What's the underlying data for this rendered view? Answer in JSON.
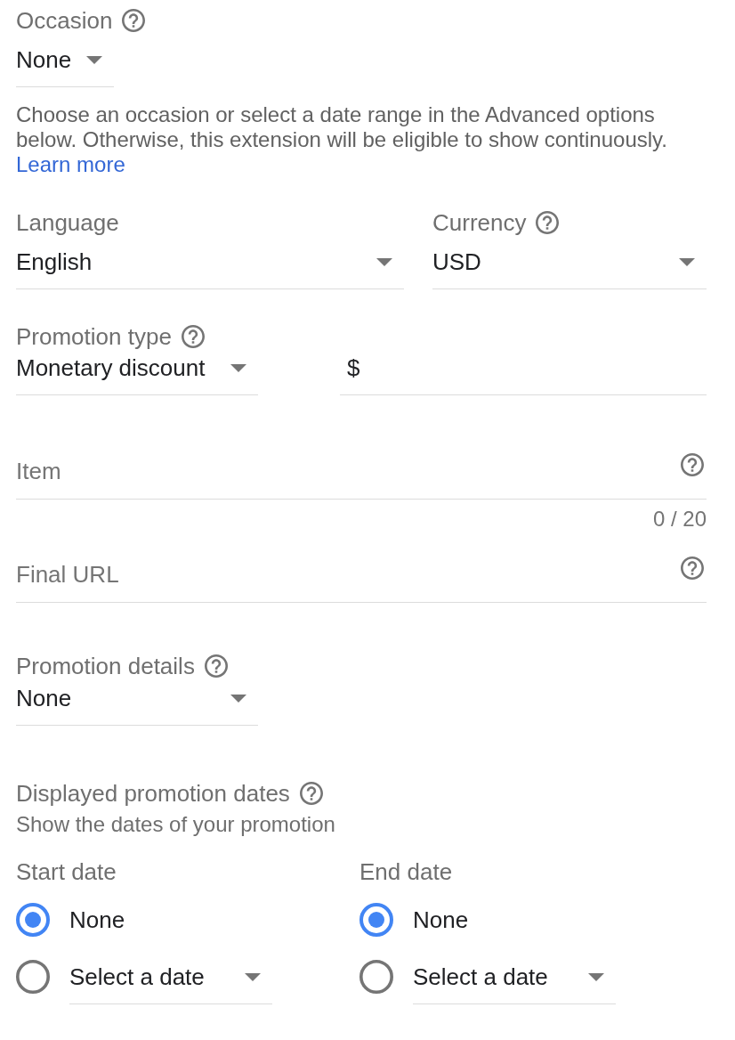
{
  "occasion": {
    "label": "Occasion",
    "help": true,
    "value": "None",
    "note": "Choose an occasion or select a date range in the Advanced options below. Otherwise, this extension will be eligible to show continuously.",
    "link": "Learn more"
  },
  "language": {
    "label": "Language",
    "help": false,
    "value": "English"
  },
  "currency": {
    "label": "Currency",
    "help": true,
    "value": "USD"
  },
  "promotion_type": {
    "label": "Promotion type",
    "help": true,
    "value": "Monetary discount"
  },
  "amount": {
    "prefix": "$"
  },
  "item": {
    "placeholder": "Item",
    "help": true,
    "counter": "0 / 20"
  },
  "final_url": {
    "placeholder": "Final URL",
    "help": true
  },
  "promotion_details": {
    "label": "Promotion details",
    "help": true,
    "value": "None"
  },
  "displayed_dates": {
    "title": "Displayed promotion dates",
    "help": true,
    "subtitle": "Show the dates of your promotion",
    "columns": [
      {
        "label": "Start date",
        "options": [
          {
            "kind": "plain",
            "label": "None",
            "selected": true
          },
          {
            "kind": "dropdown",
            "label": "Select a date",
            "selected": false
          }
        ]
      },
      {
        "label": "End date",
        "options": [
          {
            "kind": "plain",
            "label": "None",
            "selected": true
          },
          {
            "kind": "dropdown",
            "label": "Select a date",
            "selected": false
          }
        ]
      }
    ]
  }
}
